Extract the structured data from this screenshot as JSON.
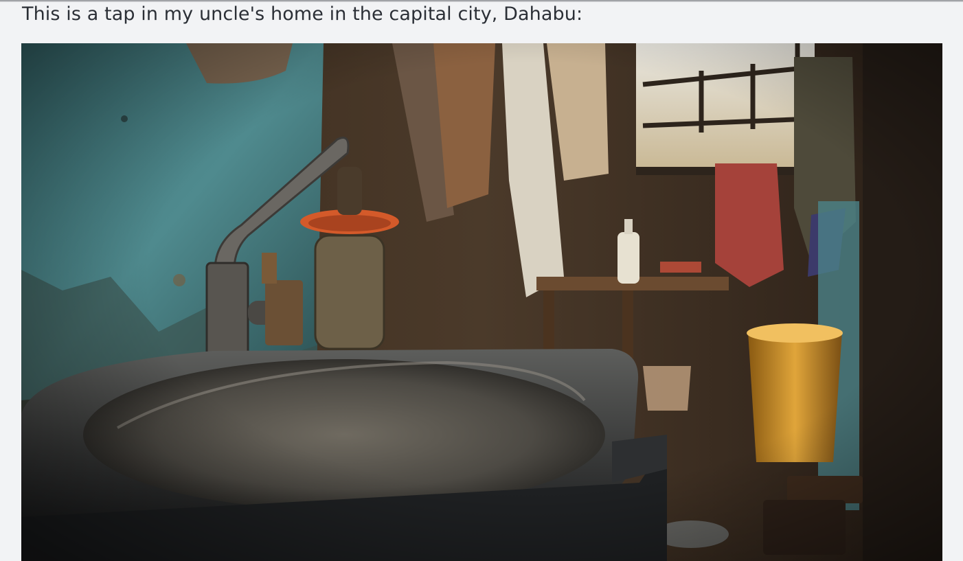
{
  "message": {
    "text": "This is a tap in my uncle's home in the capital city, Dahabu:"
  },
  "photo": {
    "subject": "Worn metal sink with an old faucet in a dim room with hanging clothes, a window, a small table with a bottle, and a yellow bucket"
  }
}
